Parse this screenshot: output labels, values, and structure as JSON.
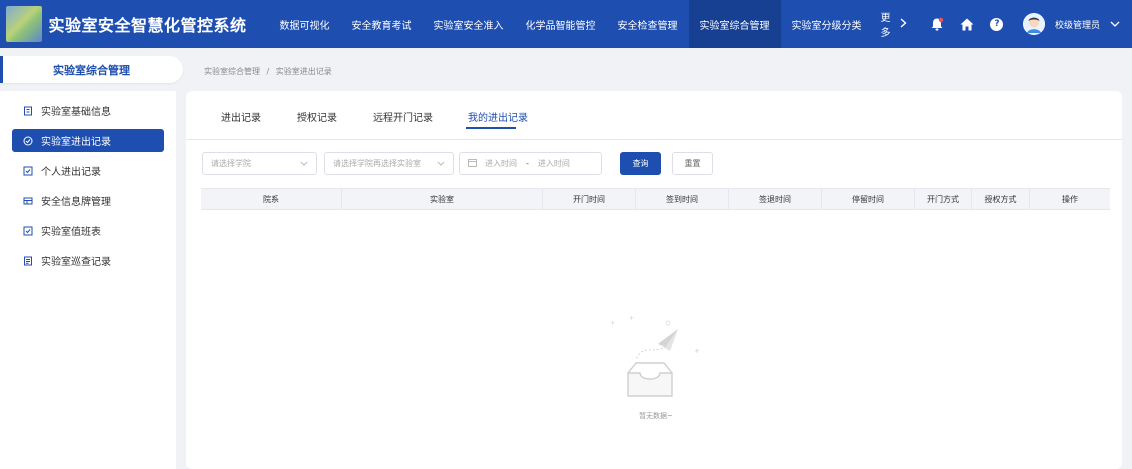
{
  "app": {
    "title": "实验室安全智慧化管控系统"
  },
  "nav": {
    "items": [
      {
        "label": "数据可视化",
        "active": false
      },
      {
        "label": "安全教育考试",
        "active": false
      },
      {
        "label": "实验室安全准入",
        "active": false
      },
      {
        "label": "化学品智能管控",
        "active": false
      },
      {
        "label": "安全检查管理",
        "active": false
      },
      {
        "label": "实验室综合管理",
        "active": true
      },
      {
        "label": "实验室分级分类",
        "active": false
      }
    ],
    "more_label": "更多",
    "more_icon": "chevron-right-icon"
  },
  "user": {
    "name": "校级管理员",
    "caret_icon": "chevron-down-icon"
  },
  "top_icons": [
    "bell-icon",
    "home-icon",
    "help-icon",
    "avatar"
  ],
  "sidebar": {
    "header": "实验室综合管理",
    "items": [
      {
        "label": "实验室基础信息",
        "icon": "building-icon",
        "active": false
      },
      {
        "label": "实验室进出记录",
        "icon": "record-icon",
        "active": true
      },
      {
        "label": "个人进出记录",
        "icon": "checklist-icon",
        "active": false
      },
      {
        "label": "安全信息牌管理",
        "icon": "board-icon",
        "active": false
      },
      {
        "label": "实验室值班表",
        "icon": "checklist-icon",
        "active": false
      },
      {
        "label": "实验室巡查记录",
        "icon": "document-icon",
        "active": false
      }
    ]
  },
  "breadcrumb": {
    "parent": "实验室综合管理",
    "separator": "/",
    "current": "实验室进出记录"
  },
  "tabs": [
    {
      "label": "进出记录",
      "active": false
    },
    {
      "label": "授权记录",
      "active": false
    },
    {
      "label": "远程开门记录",
      "active": false
    },
    {
      "label": "我的进出记录",
      "active": true
    }
  ],
  "filters": {
    "college_placeholder": "请选择学院",
    "lab_placeholder": "请选择学院再选择实验室",
    "start_placeholder": "进入时间",
    "range_separator": "-",
    "end_placeholder": "进入时间",
    "query_label": "查询",
    "reset_label": "重置"
  },
  "table": {
    "columns": [
      "院系",
      "实验室",
      "开门时间",
      "签到时间",
      "签退时间",
      "停留时间",
      "开门方式",
      "授权方式",
      "操作"
    ],
    "rows": [],
    "empty_text": "暂无数据~"
  },
  "colors": {
    "primary": "#1e4fb0",
    "nav_active": "#173f92",
    "header_bg": "#f2f4f7",
    "page_bg": "#f0f2f5"
  }
}
